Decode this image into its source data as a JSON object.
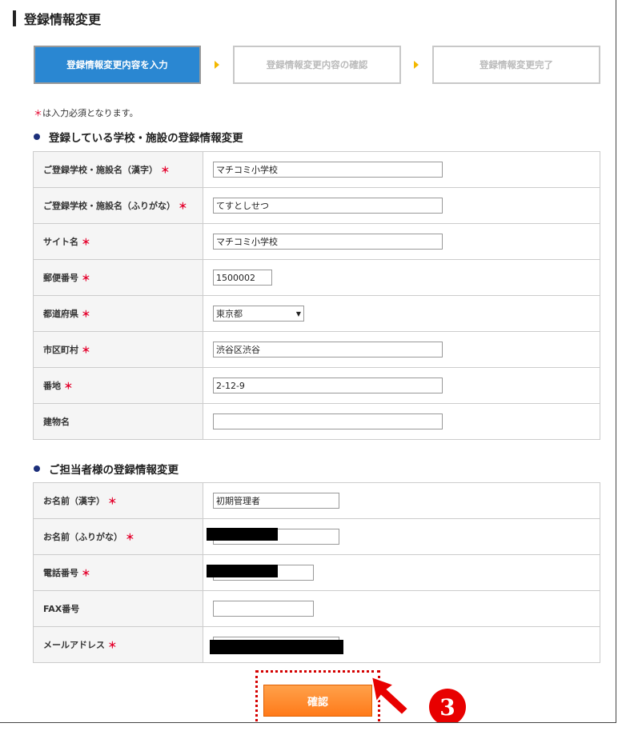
{
  "page_title": "登録情報変更",
  "steps": [
    {
      "label": "登録情報変更内容を入力"
    },
    {
      "label": "登録情報変更内容の確認"
    },
    {
      "label": "登録情報変更完了"
    }
  ],
  "required_note": {
    "star": "＊",
    "text": "は入力必須となります。"
  },
  "required_mark": "＊",
  "section_school": {
    "heading": "登録している学校・施設の登録情報変更",
    "rows": [
      {
        "label": "ご登録学校・施設名（漢字）",
        "value": "マチコミ小学校"
      },
      {
        "label": "ご登録学校・施設名（ふりがな）",
        "value": "てすとしせつ"
      },
      {
        "label": "サイト名",
        "value": "マチコミ小学校"
      },
      {
        "label": "郵便番号",
        "value": "1500002"
      },
      {
        "label": "都道府県",
        "value": "東京都"
      },
      {
        "label": "市区町村",
        "value": "渋谷区渋谷"
      },
      {
        "label": "番地",
        "value": "2-12-9"
      },
      {
        "label": "建物名",
        "value": ""
      }
    ]
  },
  "section_contact": {
    "heading": "ご担当者様の登録情報変更",
    "rows": [
      {
        "label": "お名前（漢字）",
        "value": "初期管理者"
      },
      {
        "label": "お名前（ふりがな）",
        "value": ""
      },
      {
        "label": "電話番号",
        "value": ""
      },
      {
        "label": "FAX番号",
        "value": ""
      },
      {
        "label": "メールアドレス",
        "value": ""
      }
    ]
  },
  "confirm_button": "確認",
  "step_badge": "3",
  "colors": {
    "accent_blue": "#2a87d2",
    "required_red": "#e4002b",
    "button_orange": "#ff8a2a",
    "annotation_red": "#e80000"
  }
}
